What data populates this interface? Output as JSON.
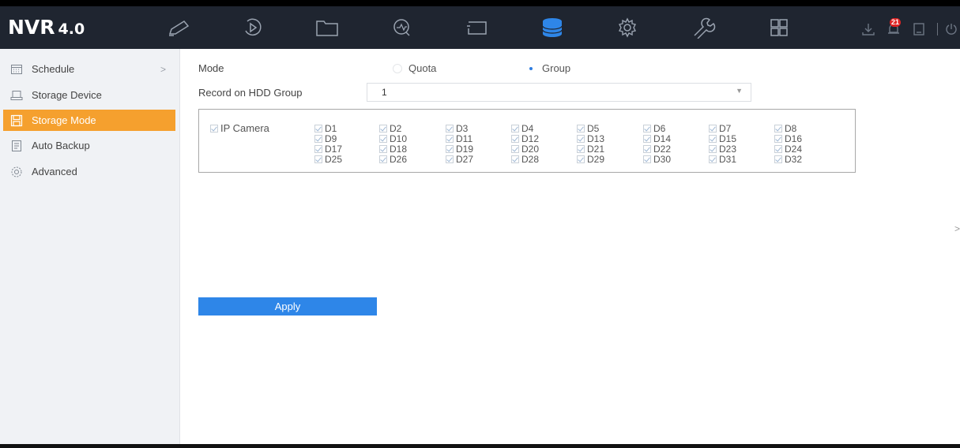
{
  "app": {
    "logo_main": "NVR",
    "logo_version": "4.0"
  },
  "topnav": {
    "items": [
      {
        "name": "live-view",
        "icon": "camera-icon"
      },
      {
        "name": "playback",
        "icon": "playback-icon"
      },
      {
        "name": "file-management",
        "icon": "folder-icon"
      },
      {
        "name": "smart-analysis",
        "icon": "analysis-icon"
      },
      {
        "name": "picture",
        "icon": "screen-icon"
      },
      {
        "name": "storage",
        "icon": "database-icon",
        "active": true
      },
      {
        "name": "configuration",
        "icon": "gear-icon"
      },
      {
        "name": "maintenance",
        "icon": "wrench-icon"
      },
      {
        "name": "menu-grid",
        "icon": "grid-icon"
      }
    ],
    "tools": {
      "alarm_count": "21"
    },
    "active_color": "#2e86e8"
  },
  "sidebar": {
    "items": [
      {
        "label": "Schedule",
        "icon": "calendar-icon",
        "has_arrow": true,
        "arrow": ">"
      },
      {
        "label": "Storage Device",
        "icon": "hdd-icon"
      },
      {
        "label": "Storage Mode",
        "icon": "save-icon",
        "active": true
      },
      {
        "label": "Auto Backup",
        "icon": "backup-icon"
      },
      {
        "label": "Advanced",
        "icon": "gear-icon"
      }
    ],
    "active_color": "#f5a02e"
  },
  "form": {
    "mode_label": "Mode",
    "mode_options": [
      {
        "label": "Quota",
        "selected": false
      },
      {
        "label": "Group",
        "selected": true
      }
    ],
    "hdd_group_label": "Record on HDD Group",
    "hdd_group_value": "1",
    "ip_camera_label": "IP Camera",
    "cameras": [
      "D1",
      "D2",
      "D3",
      "D4",
      "D5",
      "D6",
      "D7",
      "D8",
      "D9",
      "D10",
      "D11",
      "D12",
      "D13",
      "D14",
      "D15",
      "D16",
      "D17",
      "D18",
      "D19",
      "D20",
      "D21",
      "D22",
      "D23",
      "D24",
      "D25",
      "D26",
      "D27",
      "D28",
      "D29",
      "D30",
      "D31",
      "D32"
    ],
    "apply_label": "Apply",
    "scroll_hint": ">"
  }
}
